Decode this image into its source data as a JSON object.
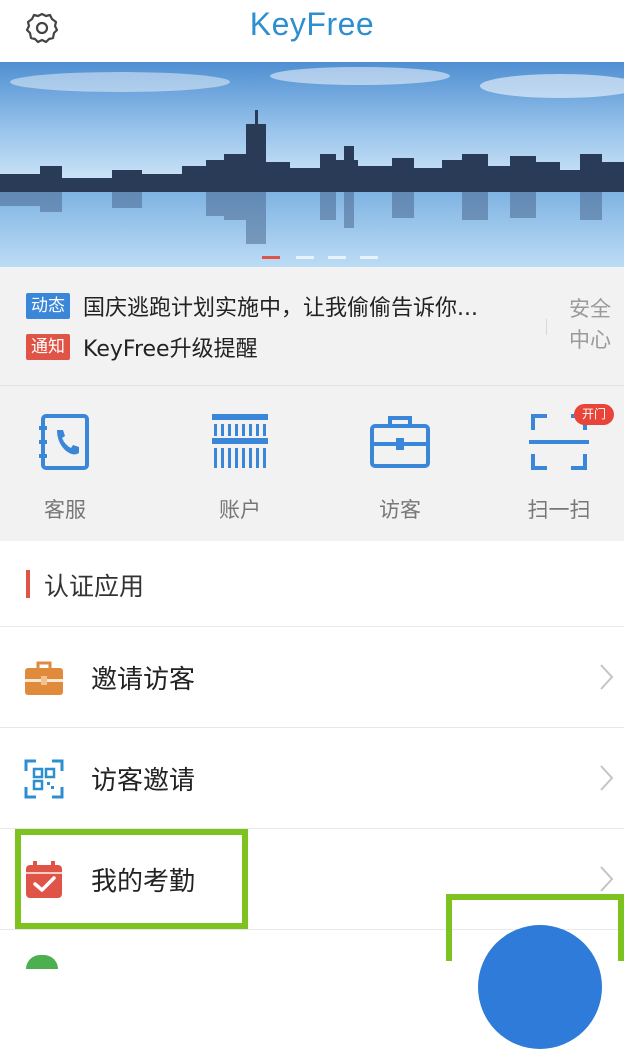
{
  "app": {
    "title": "KeyFree"
  },
  "notices": [
    {
      "tag": "动态",
      "text": "国庆逃跑计划实施中，让我偷偷告诉你..."
    },
    {
      "tag": "通知",
      "text": "KeyFree升级提醒"
    }
  ],
  "security_center": {
    "line1": "安全",
    "line2": "中心"
  },
  "quick_actions": [
    {
      "label": "客服",
      "icon": "phone-book-icon"
    },
    {
      "label": "账户",
      "icon": "barcode-icon"
    },
    {
      "label": "访客",
      "icon": "briefcase-icon"
    },
    {
      "label": "扫一扫",
      "icon": "scan-icon",
      "badge": "开门"
    }
  ],
  "section": {
    "title": "认证应用"
  },
  "apps": [
    {
      "label": "邀请访客",
      "icon": "briefcase-icon"
    },
    {
      "label": "访客邀请",
      "icon": "qr-scan-icon"
    },
    {
      "label": "我的考勤",
      "icon": "calendar-check-icon"
    }
  ],
  "colors": {
    "brand": "#2e8fd0",
    "accent_red": "#e05448",
    "highlight": "#7dc21f",
    "tag_blue": "#3a86d8"
  }
}
